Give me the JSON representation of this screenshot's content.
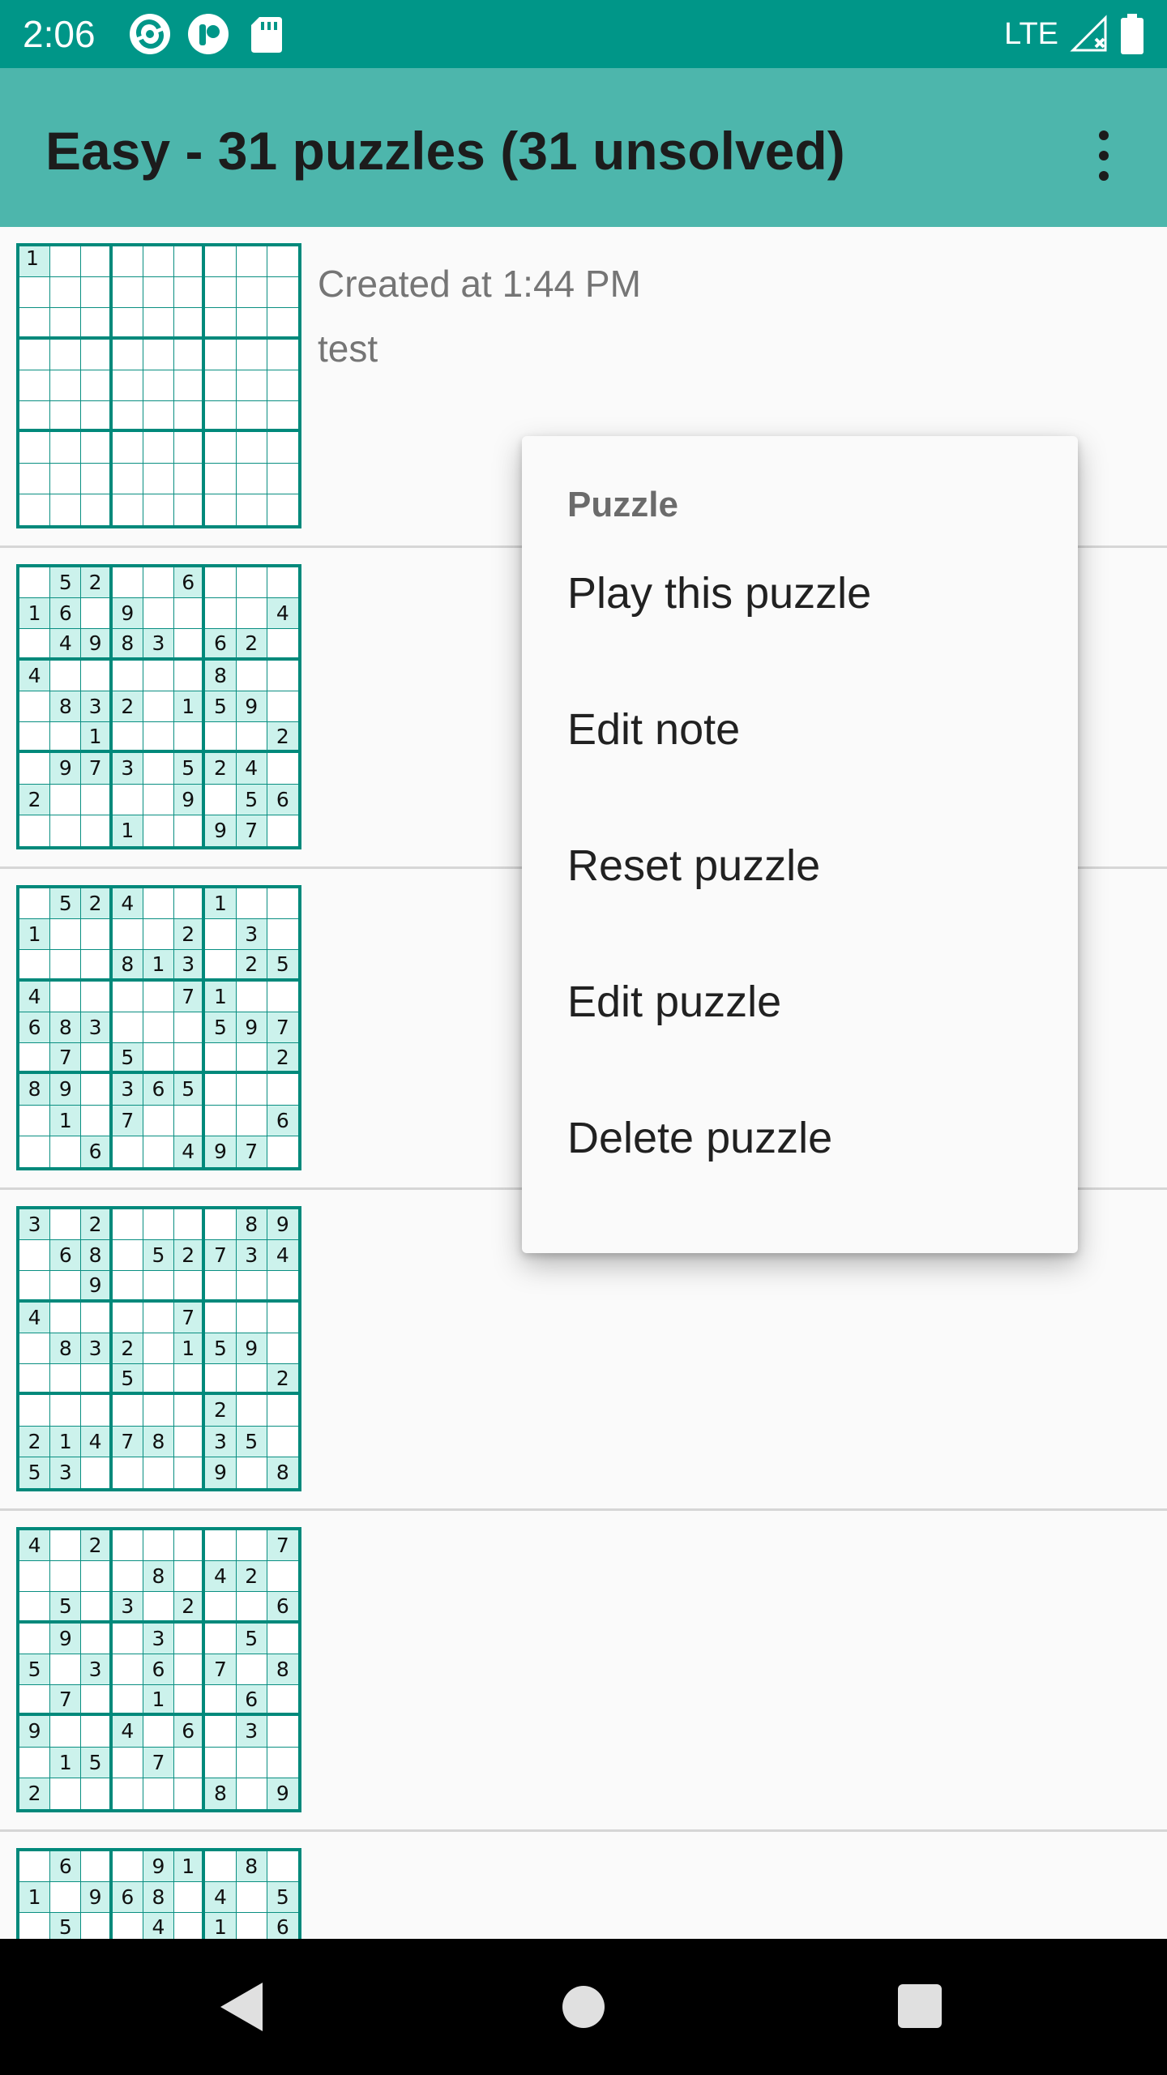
{
  "status_bar": {
    "time": "2:06",
    "network": "LTE",
    "icons": [
      "sync-icon",
      "app-notification-icon",
      "sd-card-icon",
      "signal-icon",
      "battery-icon"
    ]
  },
  "app_bar": {
    "title": "Easy - 31 puzzles (31 unsolved)",
    "overflow_icon": "more-vert-icon"
  },
  "puzzles": [
    {
      "created": "Created at 1:44 PM",
      "note": "test",
      "grid": [
        "1........",
        ".........",
        ".........",
        ".........",
        ".........",
        ".........",
        ".........",
        ".........",
        "........."
      ]
    },
    {
      "created": "",
      "note": "",
      "grid": [
        ".52..6...",
        "16.9....4",
        ".4983.62.",
        "4.....8..",
        ".832.159.",
        "..1.....2",
        ".973.524.",
        "2....9.56",
        "...1..97."
      ]
    },
    {
      "created": "",
      "note": "",
      "grid": [
        ".524..1..",
        "1....2.3.",
        "...813.25",
        "4....71..",
        "683...597",
        ".7.5....2",
        "89.365...",
        ".1.7....6",
        "..6..497."
      ]
    },
    {
      "created": "",
      "note": "",
      "grid": [
        "3.2....89",
        ".68.52734",
        "..9......",
        "4....7...",
        ".832.159.",
        "...5....2",
        "......2..",
        "21478.35.",
        "53....9.8"
      ]
    },
    {
      "created": "",
      "note": "",
      "grid": [
        "4.2.....7",
        "....8.42.",
        ".5.3.2..6",
        ".9..3..5.",
        "5.3.6.7.8",
        ".7..1..6.",
        "9..4.6.3.",
        ".15.7....",
        "2.....8.9"
      ]
    },
    {
      "created": "",
      "note": "",
      "grid": [
        ".6..91.8.",
        "1.968.4.5",
        ".5..4.1.6",
        ".........",
        ".........",
        ".........",
        ".........",
        ".........",
        "........."
      ]
    }
  ],
  "context_menu": {
    "header": "Puzzle",
    "items": [
      {
        "label": "Play this puzzle"
      },
      {
        "label": "Edit note"
      },
      {
        "label": "Reset puzzle"
      },
      {
        "label": "Edit puzzle"
      },
      {
        "label": "Delete puzzle"
      }
    ]
  },
  "nav_bar": {
    "icons": [
      "back-icon",
      "home-icon",
      "recents-icon"
    ]
  }
}
